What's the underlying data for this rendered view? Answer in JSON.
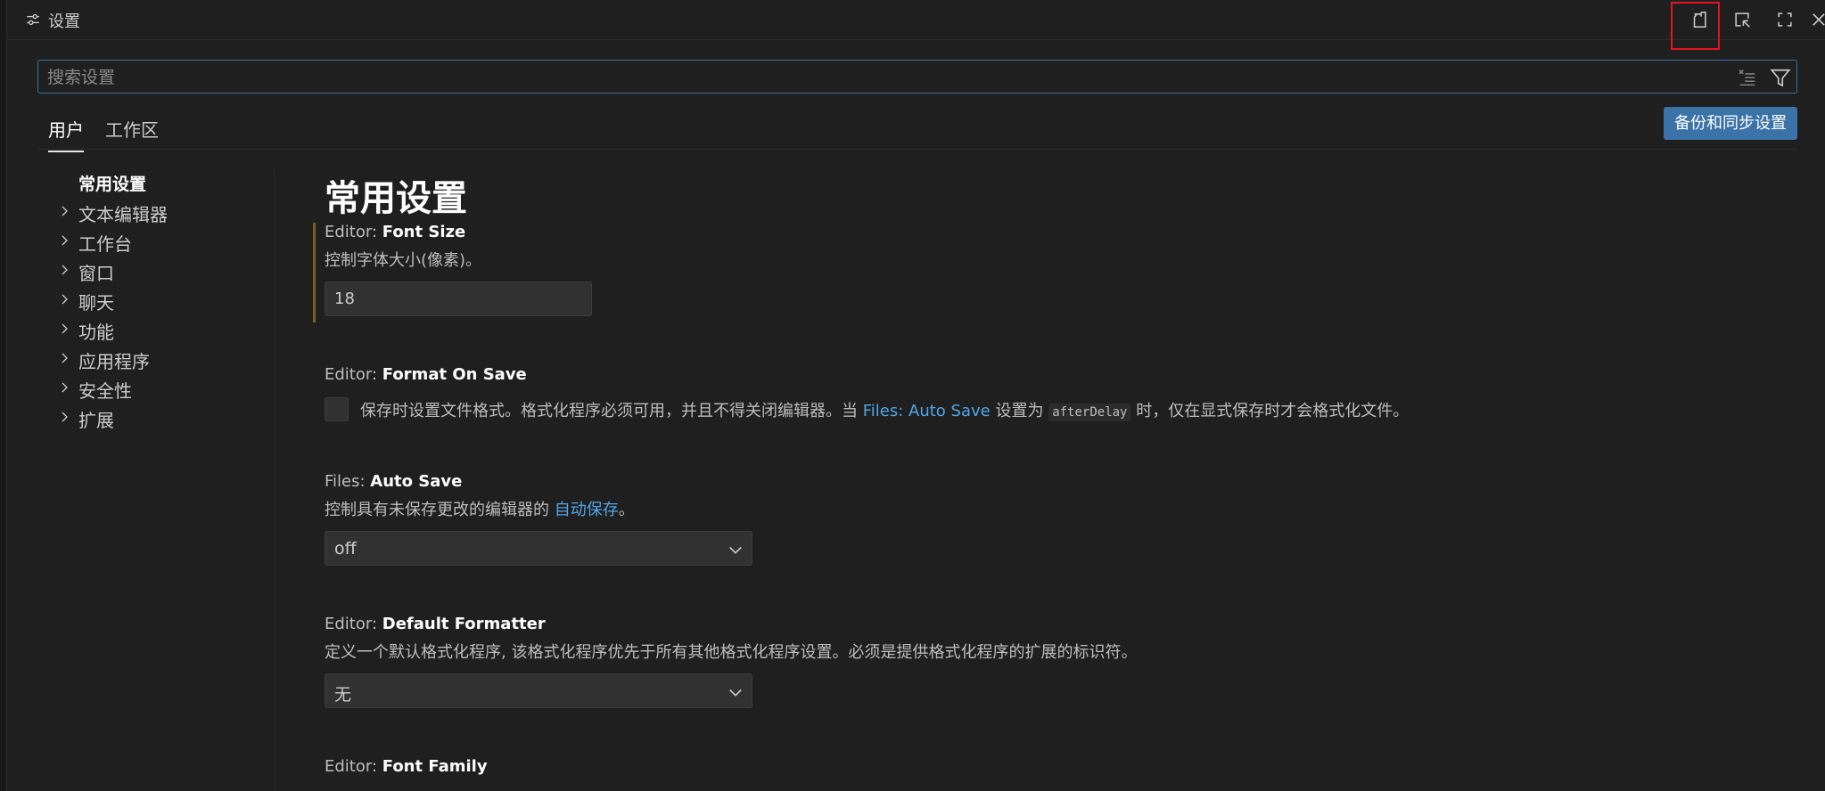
{
  "window": {
    "title": "设置",
    "icons": [
      "settings-sliders-icon",
      "open-settings-json-icon",
      "pick-element-icon",
      "maximize-icon",
      "close-icon"
    ]
  },
  "search": {
    "placeholder": "搜索设置"
  },
  "scope_tabs": [
    {
      "label": "用户",
      "active": true
    },
    {
      "label": "工作区",
      "active": false
    }
  ],
  "sync_button": "备份和同步设置",
  "toc": {
    "items": [
      {
        "label": "常用设置",
        "active": true
      },
      {
        "label": "文本编辑器"
      },
      {
        "label": "工作台"
      },
      {
        "label": "窗口"
      },
      {
        "label": "聊天"
      },
      {
        "label": "功能"
      },
      {
        "label": "应用程序"
      },
      {
        "label": "安全性"
      },
      {
        "label": "扩展"
      }
    ]
  },
  "content": {
    "section_title": "常用设置",
    "font_size": {
      "category": "Editor: ",
      "name": "Font Size",
      "description": "控制字体大小(像素)。",
      "value": "18"
    },
    "format_on_save": {
      "category": "Editor: ",
      "name": "Format On Save",
      "desc_part1": "保存时设置文件格式。格式化程序必须可用，并且不得关闭编辑器。当",
      "desc_link": "Files: Auto Save",
      "desc_part2": "设置为",
      "desc_code": "afterDelay",
      "desc_part3": "时，仅在显式保存时才会格式化文件。",
      "checked": false
    },
    "auto_save": {
      "category": "Files: ",
      "name": "Auto Save",
      "desc_part1": "控制具有未保存更改的编辑器的",
      "desc_link": "自动保存",
      "desc_part2": "。",
      "value": "off"
    },
    "default_formatter": {
      "category": "Editor: ",
      "name": "Default Formatter",
      "description": "定义一个默认格式化程序, 该格式化程序优先于所有其他格式化程序设置。必须是提供格式化程序的扩展的标识符。",
      "value": "无"
    },
    "font_family": {
      "category": "Editor: ",
      "name": "Font Family"
    }
  },
  "colors": {
    "accent": "#3b73a8",
    "link": "#4fa6e8",
    "modified_bar": "#7a5f1e",
    "highlight": "#e3141e"
  }
}
